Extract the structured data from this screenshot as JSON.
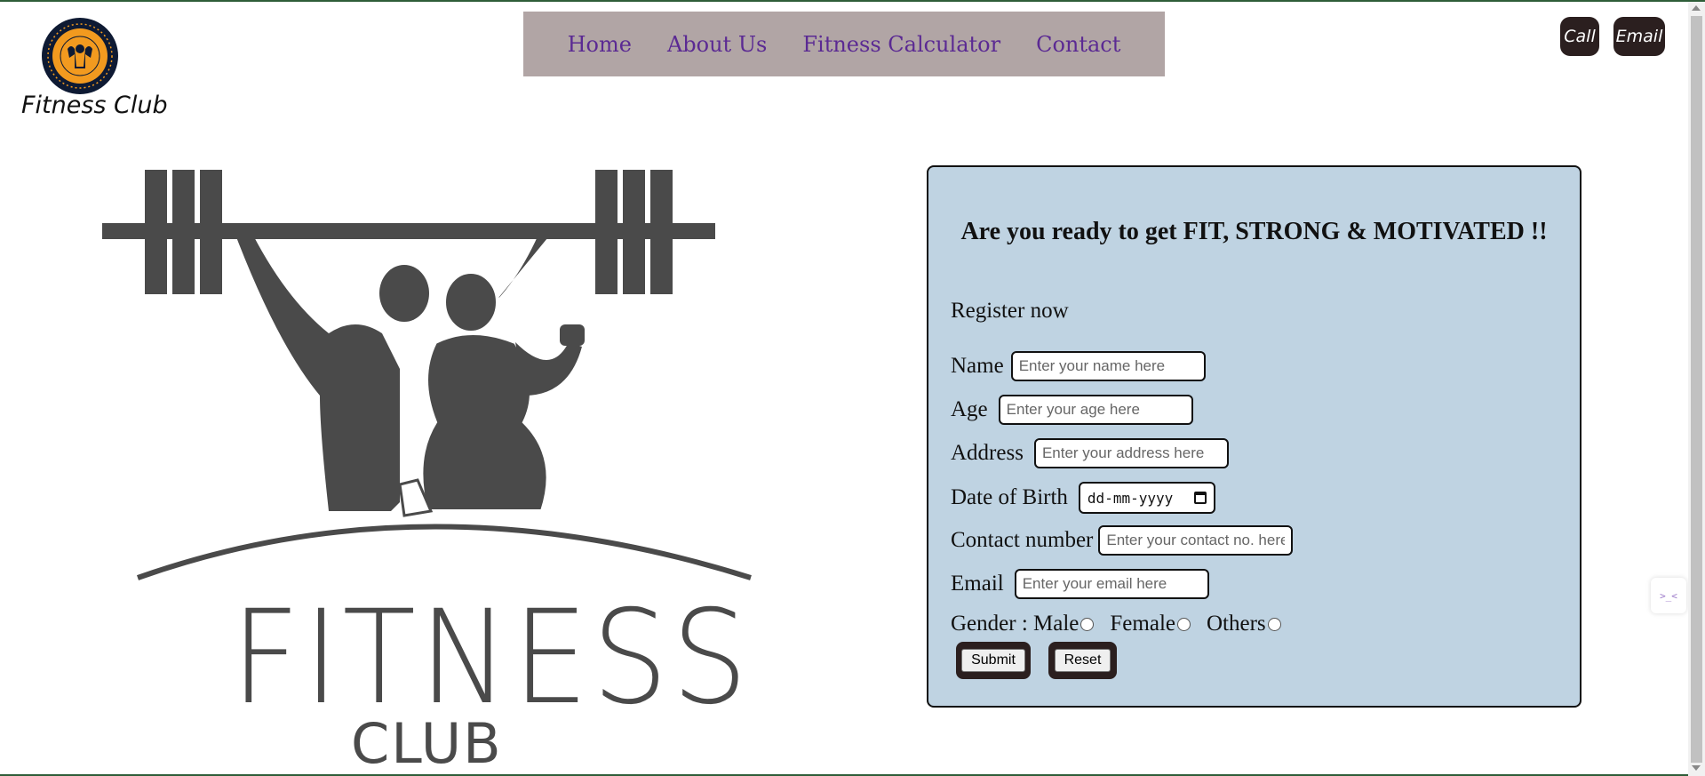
{
  "brand": {
    "name": "Fitness Club",
    "badge_text": "FITNESS CLUB"
  },
  "nav": {
    "items": [
      {
        "label": "Home"
      },
      {
        "label": "About Us"
      },
      {
        "label": "Fitness Calculator"
      },
      {
        "label": "Contact"
      }
    ]
  },
  "contact_buttons": {
    "call": "Call",
    "email": "Email"
  },
  "hero": {
    "word1": "FITNESS",
    "word2": "CLUB"
  },
  "form": {
    "heading": "Are you ready to get FIT, STRONG & MOTIVATED !!",
    "register_label": "Register now",
    "name": {
      "label": "Name",
      "placeholder": "Enter your name here"
    },
    "age": {
      "label": "Age",
      "placeholder": "Enter your age here"
    },
    "address": {
      "label": "Address",
      "placeholder": "Enter your address here"
    },
    "dob": {
      "label": "Date of Birth",
      "value": "dd-mm-yyyy"
    },
    "contact": {
      "label": "Contact number",
      "placeholder": "Enter your contact no. here"
    },
    "email": {
      "label": "Email",
      "placeholder": "Enter your email here"
    },
    "gender": {
      "label": "Gender :",
      "options": [
        "Male",
        "Female",
        "Others"
      ]
    },
    "submit_label": "Submit",
    "reset_label": "Reset"
  },
  "extension_widget": {
    "text": ">_<"
  },
  "colors": {
    "nav_bg": "#b1a5a5",
    "nav_link": "#5b2a93",
    "form_bg": "#bfd3e2",
    "dark_button": "#2b1f1f",
    "badge_orange": "#f29a1f",
    "badge_navy": "#0e1a33",
    "logo_gray": "#4a4a4a"
  }
}
